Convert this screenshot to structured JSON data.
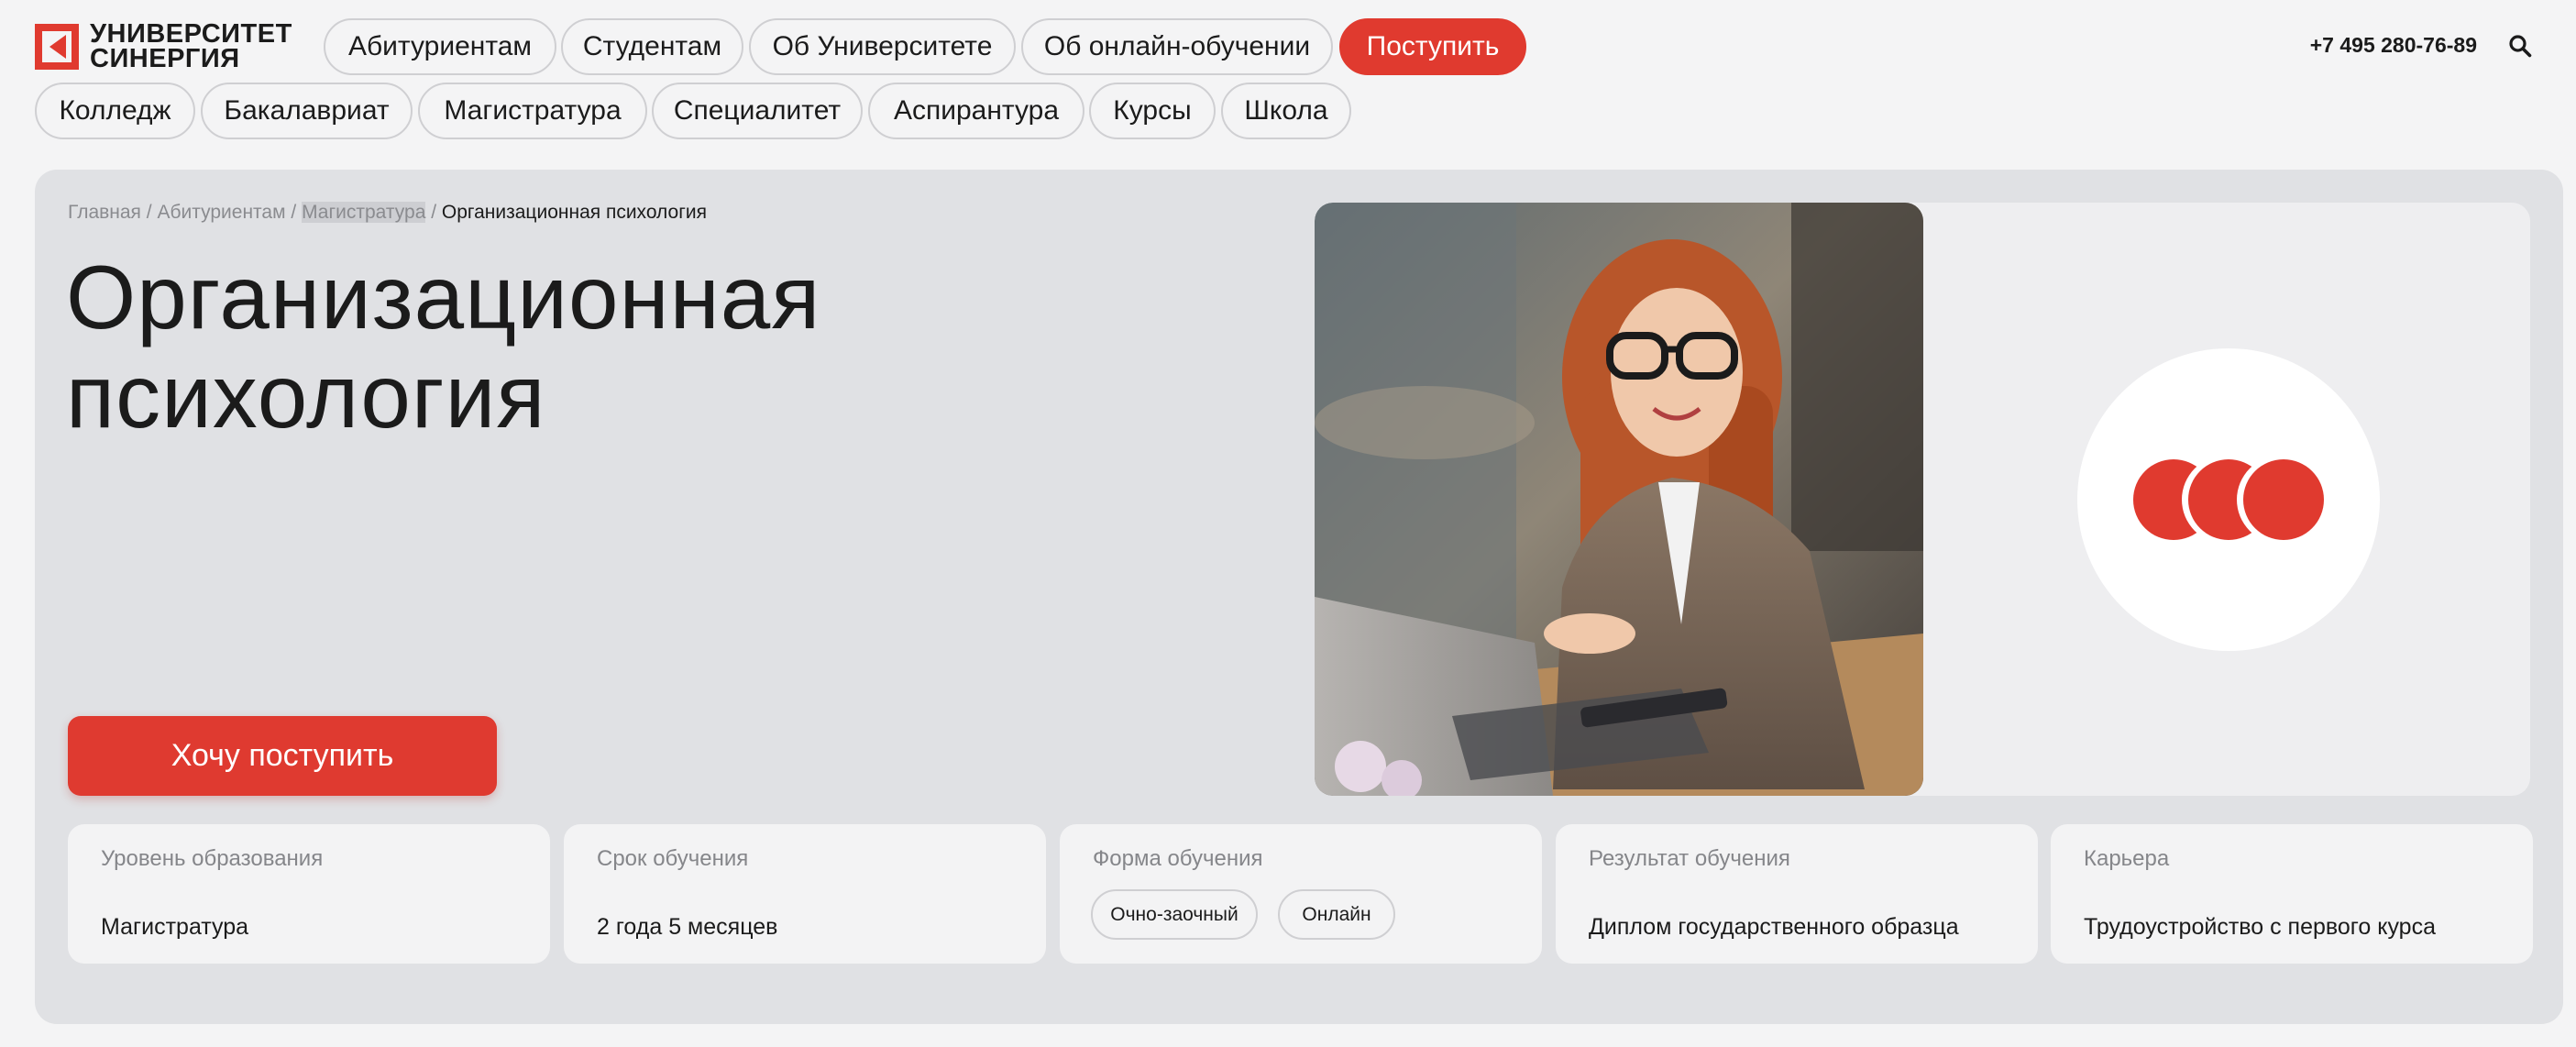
{
  "brand": {
    "line1": "УНИВЕРСИТЕТ",
    "line2": "СИНЕРГИЯ",
    "color": "#e03a2f"
  },
  "top_nav": [
    "Абитуриентам",
    "Студентам",
    "Об Университете",
    "Об онлайн-обучении"
  ],
  "apply_button": "Поступить",
  "phone": "+7 495 280-76-89",
  "level_nav": [
    "Колледж",
    "Бакалавриат",
    "Магистратура",
    "Специалитет",
    "Аспирантура",
    "Курсы",
    "Школа"
  ],
  "breadcrumb": {
    "items": [
      "Главная",
      "Абитуриентам",
      "Магистратура"
    ],
    "current": "Организационная психология",
    "separator": "/"
  },
  "hero": {
    "title_line1": "Организационная",
    "title_line2": "психология",
    "cta": "Хочу поступить"
  },
  "info_cards": [
    {
      "label": "Уровень образования",
      "value": "Магистратура"
    },
    {
      "label": "Срок обучения",
      "value": "2 года 5 месяцев"
    },
    {
      "label": "Форма обучения",
      "chips": [
        "Очно-заочный",
        "Онлайн"
      ]
    },
    {
      "label": "Результат обучения",
      "value": "Диплом государственного образца"
    },
    {
      "label": "Карьера",
      "value": "Трудоустройство с первого курса"
    }
  ],
  "colors": {
    "accent": "#e03a2f",
    "hero_bg": "#e0e1e4",
    "page_bg": "#f4f4f5"
  }
}
